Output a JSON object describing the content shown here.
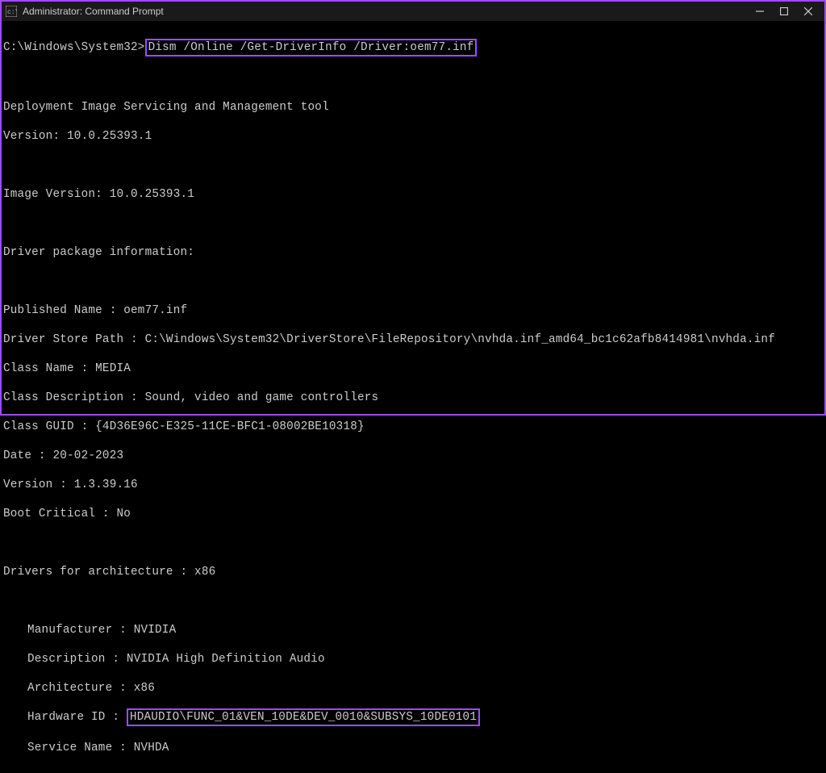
{
  "titlebar": {
    "title": "Administrator: Command Prompt"
  },
  "terminal": {
    "prompt": "C:\\Windows\\System32>",
    "command": "Dism /Online /Get-DriverInfo /Driver:oem77.inf",
    "blank1": "",
    "tool_header": "Deployment Image Servicing and Management tool",
    "tool_version": "Version: 10.0.25393.1",
    "blank2": "",
    "image_version": "Image Version: 10.0.25393.1",
    "blank3": "",
    "driver_pkg_header": "Driver package information:",
    "blank4": "",
    "published_name": "Published Name : oem77.inf",
    "driver_store_path": "Driver Store Path : C:\\Windows\\System32\\DriverStore\\FileRepository\\nvhda.inf_amd64_bc1c62afb8414981\\nvhda.inf",
    "class_name": "Class Name : MEDIA",
    "class_desc": "Class Description : Sound, video and game controllers",
    "class_guid": "Class GUID : {4D36E96C-E325-11CE-BFC1-08002BE10318}",
    "date": "Date : 20-02-2023",
    "version": "Version : 1.3.39.16",
    "boot_critical": "Boot Critical : No",
    "blank5": "",
    "arch_header": "Drivers for architecture : x86",
    "blank6": "",
    "manufacturer": "Manufacturer : NVIDIA",
    "description": "Description : NVIDIA High Definition Audio",
    "architecture": "Architecture : x86",
    "hardware_id_label": "Hardware ID : ",
    "hardware_id_value": "HDAUDIO\\FUNC_01&VEN_10DE&DEV_0010&SUBSYS_10DE0101",
    "service_name": "Service Name : NVHDA"
  }
}
